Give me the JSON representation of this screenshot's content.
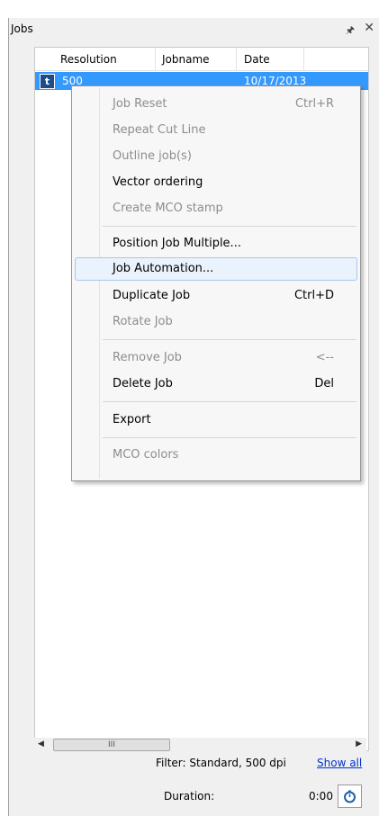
{
  "panel": {
    "title": "Jobs",
    "pin_glyph": "☐",
    "close_glyph": "✕"
  },
  "table": {
    "columns": [
      "Resolution",
      "Jobname",
      "Date"
    ],
    "rows": [
      {
        "icon_letter": "t",
        "resolution": "500",
        "jobname": "",
        "date": "10/17/2013"
      }
    ]
  },
  "context_menu": {
    "items": [
      {
        "label": "Job Reset",
        "shortcut": "Ctrl+R",
        "enabled": false
      },
      {
        "label": "Repeat Cut Line",
        "shortcut": "",
        "enabled": false
      },
      {
        "label": "Outline job(s)",
        "shortcut": "",
        "enabled": false
      },
      {
        "label": "Vector ordering",
        "shortcut": "",
        "enabled": true
      },
      {
        "label": "Create MCO stamp",
        "shortcut": "",
        "enabled": false
      },
      {
        "label": "Position Job Multiple...",
        "shortcut": "",
        "enabled": true
      },
      {
        "label": "Job Automation...",
        "shortcut": "",
        "enabled": true,
        "highlighted": true
      },
      {
        "label": "Duplicate Job",
        "shortcut": "Ctrl+D",
        "enabled": true
      },
      {
        "label": "Rotate Job",
        "shortcut": "",
        "enabled": false
      },
      {
        "label": "Remove Job",
        "shortcut": "<--",
        "enabled": false
      },
      {
        "label": "Delete Job",
        "shortcut": "Del",
        "enabled": true
      },
      {
        "label": "Export",
        "shortcut": "",
        "enabled": true
      },
      {
        "label": "MCO colors",
        "shortcut": "",
        "enabled": false
      }
    ]
  },
  "scrollbar": {
    "thumb_glyph": "III"
  },
  "footer": {
    "filter_text": "Filter: Standard, 500 dpi",
    "show_all": "Show all",
    "duration_label": "Duration:",
    "duration_value": "0:00"
  },
  "colors": {
    "selection": "#3399ff",
    "menu_hover": "#eaf2fb",
    "link": "#0033cc"
  }
}
